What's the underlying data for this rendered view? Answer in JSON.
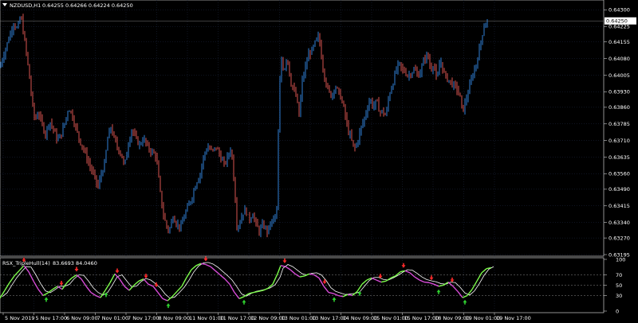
{
  "main_header": {
    "symbol": "NZDUSD,H1",
    "values": "0.64255 0.64266 0.64224 0.64250"
  },
  "indicator_header": {
    "name": "RSX_TripleHull(14)",
    "values": "83.6693 84.0460"
  },
  "price_axis": {
    "ticks": [
      "0.64300",
      "0.64225",
      "0.64155",
      "0.64080",
      "0.64005",
      "0.63930",
      "0.63860",
      "0.63785",
      "0.63710",
      "0.63635",
      "0.63560",
      "0.63490",
      "0.63415",
      "0.63340",
      "0.63270",
      "0.63195"
    ],
    "current_price_label": "0.64250"
  },
  "indicator_axis": {
    "ticks": [
      "100",
      "70",
      "50",
      "30",
      "0"
    ],
    "levels": [
      70,
      50,
      30
    ]
  },
  "time_axis": {
    "labels": [
      "5 Nov 2019",
      "5 Nov 17:00",
      "6 Nov 09:00",
      "7 Nov 01:00",
      "7 Nov 17:00",
      "8 Nov 09:00",
      "11 Nov 01:00",
      "11 Nov 17:00",
      "12 Nov 09:00",
      "13 Nov 01:00",
      "13 Nov 17:00",
      "14 Nov 09:00",
      "15 Nov 01:00",
      "15 Nov 17:00",
      "18 Nov 09:00",
      "19 Nov 01:00",
      "19 Nov 17:00"
    ]
  },
  "colors": {
    "background": "#000000",
    "grid": "#1f2a44",
    "bull_candle": "#2f7fd6",
    "bear_candle": "#d9534f",
    "indicator_up": "#7cfc4a",
    "indicator_down": "#d84cd8",
    "indicator_signal": "#ffffff",
    "arrow_down": "#ff2a2a",
    "arrow_up": "#2fd02f"
  },
  "chart_data": {
    "type": "candlestick",
    "symbol": "NZDUSD",
    "timeframe": "H1",
    "ylim": [
      0.63195,
      0.6433
    ],
    "price_path": [
      [
        0,
        0.6404
      ],
      [
        3,
        0.6408
      ],
      [
        10,
        0.6416
      ],
      [
        17,
        0.6424
      ],
      [
        22,
        0.6421
      ],
      [
        26,
        0.6428
      ],
      [
        30,
        0.6418
      ],
      [
        34,
        0.6408
      ],
      [
        38,
        0.6396
      ],
      [
        41,
        0.6386
      ],
      [
        44,
        0.638
      ],
      [
        48,
        0.6384
      ],
      [
        52,
        0.6379
      ],
      [
        57,
        0.6374
      ],
      [
        62,
        0.638
      ],
      [
        67,
        0.6376
      ],
      [
        72,
        0.6371
      ],
      [
        77,
        0.6374
      ],
      [
        82,
        0.638
      ],
      [
        86,
        0.6386
      ],
      [
        90,
        0.6383
      ],
      [
        94,
        0.6378
      ],
      [
        100,
        0.6371
      ],
      [
        106,
        0.6366
      ],
      [
        112,
        0.636
      ],
      [
        118,
        0.6355
      ],
      [
        123,
        0.635
      ],
      [
        127,
        0.6356
      ],
      [
        131,
        0.636
      ],
      [
        135,
        0.6372
      ],
      [
        139,
        0.6377
      ],
      [
        143,
        0.6372
      ],
      [
        147,
        0.6368
      ],
      [
        152,
        0.6365
      ],
      [
        156,
        0.6359
      ],
      [
        160,
        0.6368
      ],
      [
        165,
        0.6376
      ],
      [
        170,
        0.6372
      ],
      [
        175,
        0.6369
      ],
      [
        180,
        0.6372
      ],
      [
        185,
        0.6368
      ],
      [
        190,
        0.6366
      ],
      [
        196,
        0.6364
      ],
      [
        200,
        0.635
      ],
      [
        204,
        0.6339
      ],
      [
        208,
        0.6333
      ],
      [
        212,
        0.633
      ],
      [
        217,
        0.6337
      ],
      [
        222,
        0.6333
      ],
      [
        227,
        0.6332
      ],
      [
        232,
        0.6338
      ],
      [
        237,
        0.6342
      ],
      [
        241,
        0.6346
      ],
      [
        246,
        0.6352
      ],
      [
        251,
        0.6356
      ],
      [
        256,
        0.6365
      ],
      [
        261,
        0.6368
      ],
      [
        266,
        0.6366
      ],
      [
        271,
        0.6368
      ],
      [
        276,
        0.6364
      ],
      [
        281,
        0.636
      ],
      [
        286,
        0.6364
      ],
      [
        290,
        0.6368
      ],
      [
        294,
        0.635
      ],
      [
        297,
        0.6333
      ],
      [
        300,
        0.6333
      ],
      [
        304,
        0.6338
      ],
      [
        308,
        0.634
      ],
      [
        312,
        0.6335
      ],
      [
        317,
        0.6338
      ],
      [
        321,
        0.6333
      ],
      [
        325,
        0.633
      ],
      [
        330,
        0.6333
      ],
      [
        335,
        0.633
      ],
      [
        340,
        0.6334
      ],
      [
        344,
        0.6336
      ],
      [
        347,
        0.6339
      ],
      [
        350,
        0.6392
      ],
      [
        353,
        0.6408
      ],
      [
        356,
        0.6402
      ],
      [
        360,
        0.641
      ],
      [
        364,
        0.6398
      ],
      [
        368,
        0.6394
      ],
      [
        372,
        0.639
      ],
      [
        375,
        0.6382
      ],
      [
        379,
        0.6398
      ],
      [
        383,
        0.6404
      ],
      [
        387,
        0.641
      ],
      [
        392,
        0.6412
      ],
      [
        396,
        0.6416
      ],
      [
        400,
        0.6418
      ],
      [
        404,
        0.6406
      ],
      [
        408,
        0.6398
      ],
      [
        412,
        0.6393
      ],
      [
        416,
        0.6391
      ],
      [
        420,
        0.6396
      ],
      [
        424,
        0.6393
      ],
      [
        428,
        0.639
      ],
      [
        432,
        0.6384
      ],
      [
        436,
        0.6376
      ],
      [
        440,
        0.6372
      ],
      [
        444,
        0.6367
      ],
      [
        448,
        0.637
      ],
      [
        452,
        0.6376
      ],
      [
        456,
        0.638
      ],
      [
        460,
        0.6385
      ],
      [
        464,
        0.639
      ],
      [
        468,
        0.6386
      ],
      [
        472,
        0.6389
      ],
      [
        476,
        0.6384
      ],
      [
        480,
        0.6384
      ],
      [
        484,
        0.6382
      ],
      [
        488,
        0.6392
      ],
      [
        492,
        0.6396
      ],
      [
        496,
        0.6402
      ],
      [
        500,
        0.6406
      ],
      [
        504,
        0.6403
      ],
      [
        508,
        0.6402
      ],
      [
        512,
        0.64
      ],
      [
        516,
        0.6402
      ],
      [
        520,
        0.6403
      ],
      [
        524,
        0.64
      ],
      [
        528,
        0.6403
      ],
      [
        532,
        0.6408
      ],
      [
        536,
        0.641
      ],
      [
        540,
        0.6403
      ],
      [
        544,
        0.6406
      ],
      [
        548,
        0.6397
      ],
      [
        552,
        0.6408
      ],
      [
        556,
        0.6402
      ],
      [
        560,
        0.6399
      ],
      [
        564,
        0.6398
      ],
      [
        568,
        0.6396
      ],
      [
        572,
        0.6395
      ],
      [
        576,
        0.6392
      ],
      [
        580,
        0.6384
      ],
      [
        584,
        0.6389
      ],
      [
        588,
        0.6394
      ],
      [
        592,
        0.64
      ],
      [
        596,
        0.6404
      ],
      [
        600,
        0.641
      ],
      [
        604,
        0.6418
      ],
      [
        608,
        0.6424
      ],
      [
        612,
        0.6425
      ]
    ],
    "indicator": {
      "name": "RSX_TripleHull(14)",
      "levels": [
        70,
        50,
        30
      ],
      "range": [
        0,
        100
      ],
      "path": [
        [
          0,
          25
        ],
        [
          6,
          40
        ],
        [
          12,
          55
        ],
        [
          18,
          68
        ],
        [
          24,
          78
        ],
        [
          30,
          88
        ],
        [
          36,
          76
        ],
        [
          42,
          58
        ],
        [
          48,
          42
        ],
        [
          54,
          30
        ],
        [
          60,
          35
        ],
        [
          66,
          42
        ],
        [
          72,
          48
        ],
        [
          78,
          42
        ],
        [
          84,
          55
        ],
        [
          90,
          64
        ],
        [
          96,
          70
        ],
        [
          102,
          62
        ],
        [
          108,
          48
        ],
        [
          114,
          36
        ],
        [
          120,
          30
        ],
        [
          126,
          26
        ],
        [
          132,
          40
        ],
        [
          138,
          55
        ],
        [
          144,
          72
        ],
        [
          150,
          62
        ],
        [
          156,
          48
        ],
        [
          162,
          40
        ],
        [
          168,
          50
        ],
        [
          174,
          58
        ],
        [
          180,
          62
        ],
        [
          186,
          52
        ],
        [
          192,
          48
        ],
        [
          198,
          36
        ],
        [
          204,
          24
        ],
        [
          210,
          20
        ],
        [
          216,
          28
        ],
        [
          222,
          38
        ],
        [
          228,
          48
        ],
        [
          234,
          65
        ],
        [
          240,
          80
        ],
        [
          246,
          88
        ],
        [
          252,
          92
        ],
        [
          258,
          90
        ],
        [
          264,
          86
        ],
        [
          270,
          78
        ],
        [
          276,
          70
        ],
        [
          282,
          62
        ],
        [
          288,
          52
        ],
        [
          294,
          36
        ],
        [
          300,
          24
        ],
        [
          306,
          28
        ],
        [
          312,
          34
        ],
        [
          318,
          36
        ],
        [
          324,
          38
        ],
        [
          330,
          40
        ],
        [
          336,
          44
        ],
        [
          342,
          52
        ],
        [
          348,
          72
        ],
        [
          352,
          88
        ],
        [
          358,
          86
        ],
        [
          364,
          80
        ],
        [
          370,
          72
        ],
        [
          376,
          66
        ],
        [
          382,
          68
        ],
        [
          388,
          72
        ],
        [
          394,
          70
        ],
        [
          400,
          64
        ],
        [
          406,
          48
        ],
        [
          412,
          36
        ],
        [
          418,
          34
        ],
        [
          424,
          30
        ],
        [
          430,
          28
        ],
        [
          436,
          32
        ],
        [
          442,
          30
        ],
        [
          448,
          38
        ],
        [
          454,
          52
        ],
        [
          460,
          60
        ],
        [
          466,
          64
        ],
        [
          472,
          60
        ],
        [
          478,
          56
        ],
        [
          484,
          58
        ],
        [
          490,
          64
        ],
        [
          496,
          68
        ],
        [
          502,
          76
        ],
        [
          508,
          78
        ],
        [
          514,
          74
        ],
        [
          520,
          66
        ],
        [
          526,
          60
        ],
        [
          532,
          56
        ],
        [
          538,
          55
        ],
        [
          544,
          52
        ],
        [
          550,
          48
        ],
        [
          556,
          50
        ],
        [
          562,
          56
        ],
        [
          568,
          48
        ],
        [
          574,
          38
        ],
        [
          580,
          26
        ],
        [
          586,
          30
        ],
        [
          592,
          42
        ],
        [
          598,
          58
        ],
        [
          604,
          74
        ],
        [
          610,
          82
        ],
        [
          616,
          84
        ]
      ],
      "arrows_down_x": [
        30,
        77,
        96,
        147,
        183,
        196,
        258,
        357,
        407,
        477,
        506,
        541,
        567
      ],
      "arrows_up_x": [
        58,
        133,
        211,
        306,
        419,
        451,
        550,
        583
      ]
    }
  }
}
